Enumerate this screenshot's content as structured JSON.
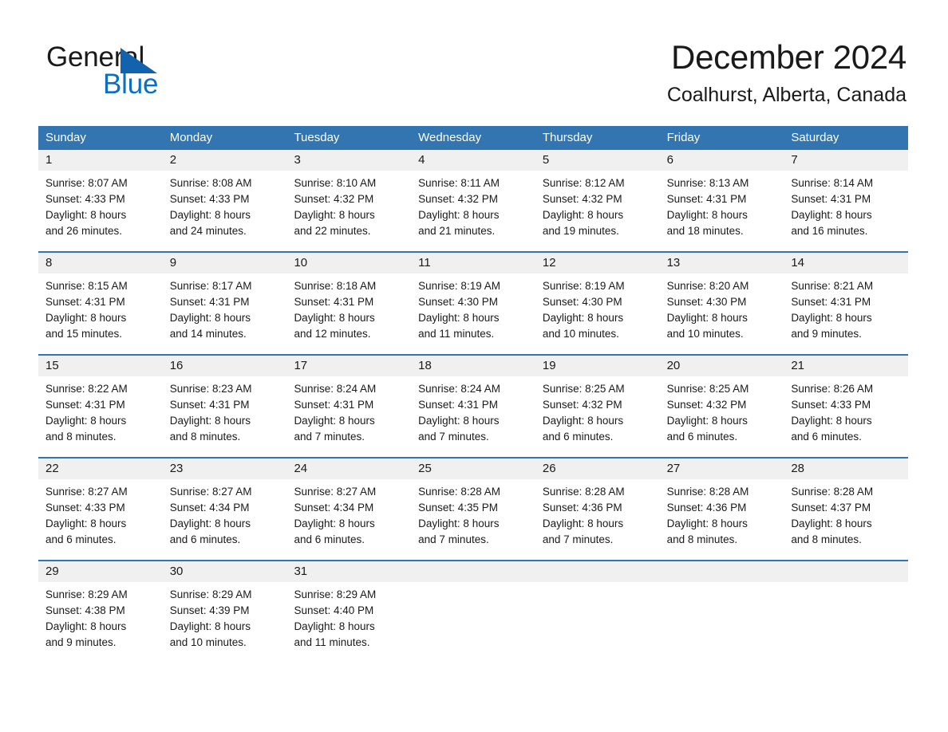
{
  "brand": {
    "name_top": "General",
    "name_bottom": "Blue",
    "triangle_color": "#1263ae",
    "blue_text_color": "#0b6fc4"
  },
  "header": {
    "month_title": "December 2024",
    "location": "Coalhurst, Alberta, Canada"
  },
  "theme": {
    "header_blue": "#3275b1",
    "row_divider_blue": "#3275b1",
    "date_band_gray": "#f0f0f0"
  },
  "weekdays": [
    "Sunday",
    "Monday",
    "Tuesday",
    "Wednesday",
    "Thursday",
    "Friday",
    "Saturday"
  ],
  "weeks": [
    {
      "days": [
        {
          "date": "1",
          "sunrise": "Sunrise: 8:07 AM",
          "sunset": "Sunset: 4:33 PM",
          "daylight_1": "Daylight: 8 hours",
          "daylight_2": "and 26 minutes."
        },
        {
          "date": "2",
          "sunrise": "Sunrise: 8:08 AM",
          "sunset": "Sunset: 4:33 PM",
          "daylight_1": "Daylight: 8 hours",
          "daylight_2": "and 24 minutes."
        },
        {
          "date": "3",
          "sunrise": "Sunrise: 8:10 AM",
          "sunset": "Sunset: 4:32 PM",
          "daylight_1": "Daylight: 8 hours",
          "daylight_2": "and 22 minutes."
        },
        {
          "date": "4",
          "sunrise": "Sunrise: 8:11 AM",
          "sunset": "Sunset: 4:32 PM",
          "daylight_1": "Daylight: 8 hours",
          "daylight_2": "and 21 minutes."
        },
        {
          "date": "5",
          "sunrise": "Sunrise: 8:12 AM",
          "sunset": "Sunset: 4:32 PM",
          "daylight_1": "Daylight: 8 hours",
          "daylight_2": "and 19 minutes."
        },
        {
          "date": "6",
          "sunrise": "Sunrise: 8:13 AM",
          "sunset": "Sunset: 4:31 PM",
          "daylight_1": "Daylight: 8 hours",
          "daylight_2": "and 18 minutes."
        },
        {
          "date": "7",
          "sunrise": "Sunrise: 8:14 AM",
          "sunset": "Sunset: 4:31 PM",
          "daylight_1": "Daylight: 8 hours",
          "daylight_2": "and 16 minutes."
        }
      ]
    },
    {
      "days": [
        {
          "date": "8",
          "sunrise": "Sunrise: 8:15 AM",
          "sunset": "Sunset: 4:31 PM",
          "daylight_1": "Daylight: 8 hours",
          "daylight_2": "and 15 minutes."
        },
        {
          "date": "9",
          "sunrise": "Sunrise: 8:17 AM",
          "sunset": "Sunset: 4:31 PM",
          "daylight_1": "Daylight: 8 hours",
          "daylight_2": "and 14 minutes."
        },
        {
          "date": "10",
          "sunrise": "Sunrise: 8:18 AM",
          "sunset": "Sunset: 4:31 PM",
          "daylight_1": "Daylight: 8 hours",
          "daylight_2": "and 12 minutes."
        },
        {
          "date": "11",
          "sunrise": "Sunrise: 8:19 AM",
          "sunset": "Sunset: 4:30 PM",
          "daylight_1": "Daylight: 8 hours",
          "daylight_2": "and 11 minutes."
        },
        {
          "date": "12",
          "sunrise": "Sunrise: 8:19 AM",
          "sunset": "Sunset: 4:30 PM",
          "daylight_1": "Daylight: 8 hours",
          "daylight_2": "and 10 minutes."
        },
        {
          "date": "13",
          "sunrise": "Sunrise: 8:20 AM",
          "sunset": "Sunset: 4:30 PM",
          "daylight_1": "Daylight: 8 hours",
          "daylight_2": "and 10 minutes."
        },
        {
          "date": "14",
          "sunrise": "Sunrise: 8:21 AM",
          "sunset": "Sunset: 4:31 PM",
          "daylight_1": "Daylight: 8 hours",
          "daylight_2": "and 9 minutes."
        }
      ]
    },
    {
      "days": [
        {
          "date": "15",
          "sunrise": "Sunrise: 8:22 AM",
          "sunset": "Sunset: 4:31 PM",
          "daylight_1": "Daylight: 8 hours",
          "daylight_2": "and 8 minutes."
        },
        {
          "date": "16",
          "sunrise": "Sunrise: 8:23 AM",
          "sunset": "Sunset: 4:31 PM",
          "daylight_1": "Daylight: 8 hours",
          "daylight_2": "and 8 minutes."
        },
        {
          "date": "17",
          "sunrise": "Sunrise: 8:24 AM",
          "sunset": "Sunset: 4:31 PM",
          "daylight_1": "Daylight: 8 hours",
          "daylight_2": "and 7 minutes."
        },
        {
          "date": "18",
          "sunrise": "Sunrise: 8:24 AM",
          "sunset": "Sunset: 4:31 PM",
          "daylight_1": "Daylight: 8 hours",
          "daylight_2": "and 7 minutes."
        },
        {
          "date": "19",
          "sunrise": "Sunrise: 8:25 AM",
          "sunset": "Sunset: 4:32 PM",
          "daylight_1": "Daylight: 8 hours",
          "daylight_2": "and 6 minutes."
        },
        {
          "date": "20",
          "sunrise": "Sunrise: 8:25 AM",
          "sunset": "Sunset: 4:32 PM",
          "daylight_1": "Daylight: 8 hours",
          "daylight_2": "and 6 minutes."
        },
        {
          "date": "21",
          "sunrise": "Sunrise: 8:26 AM",
          "sunset": "Sunset: 4:33 PM",
          "daylight_1": "Daylight: 8 hours",
          "daylight_2": "and 6 minutes."
        }
      ]
    },
    {
      "days": [
        {
          "date": "22",
          "sunrise": "Sunrise: 8:27 AM",
          "sunset": "Sunset: 4:33 PM",
          "daylight_1": "Daylight: 8 hours",
          "daylight_2": "and 6 minutes."
        },
        {
          "date": "23",
          "sunrise": "Sunrise: 8:27 AM",
          "sunset": "Sunset: 4:34 PM",
          "daylight_1": "Daylight: 8 hours",
          "daylight_2": "and 6 minutes."
        },
        {
          "date": "24",
          "sunrise": "Sunrise: 8:27 AM",
          "sunset": "Sunset: 4:34 PM",
          "daylight_1": "Daylight: 8 hours",
          "daylight_2": "and 6 minutes."
        },
        {
          "date": "25",
          "sunrise": "Sunrise: 8:28 AM",
          "sunset": "Sunset: 4:35 PM",
          "daylight_1": "Daylight: 8 hours",
          "daylight_2": "and 7 minutes."
        },
        {
          "date": "26",
          "sunrise": "Sunrise: 8:28 AM",
          "sunset": "Sunset: 4:36 PM",
          "daylight_1": "Daylight: 8 hours",
          "daylight_2": "and 7 minutes."
        },
        {
          "date": "27",
          "sunrise": "Sunrise: 8:28 AM",
          "sunset": "Sunset: 4:36 PM",
          "daylight_1": "Daylight: 8 hours",
          "daylight_2": "and 8 minutes."
        },
        {
          "date": "28",
          "sunrise": "Sunrise: 8:28 AM",
          "sunset": "Sunset: 4:37 PM",
          "daylight_1": "Daylight: 8 hours",
          "daylight_2": "and 8 minutes."
        }
      ]
    },
    {
      "days": [
        {
          "date": "29",
          "sunrise": "Sunrise: 8:29 AM",
          "sunset": "Sunset: 4:38 PM",
          "daylight_1": "Daylight: 8 hours",
          "daylight_2": "and 9 minutes."
        },
        {
          "date": "30",
          "sunrise": "Sunrise: 8:29 AM",
          "sunset": "Sunset: 4:39 PM",
          "daylight_1": "Daylight: 8 hours",
          "daylight_2": "and 10 minutes."
        },
        {
          "date": "31",
          "sunrise": "Sunrise: 8:29 AM",
          "sunset": "Sunset: 4:40 PM",
          "daylight_1": "Daylight: 8 hours",
          "daylight_2": "and 11 minutes."
        },
        {
          "date": "",
          "sunrise": "",
          "sunset": "",
          "daylight_1": "",
          "daylight_2": ""
        },
        {
          "date": "",
          "sunrise": "",
          "sunset": "",
          "daylight_1": "",
          "daylight_2": ""
        },
        {
          "date": "",
          "sunrise": "",
          "sunset": "",
          "daylight_1": "",
          "daylight_2": ""
        },
        {
          "date": "",
          "sunrise": "",
          "sunset": "",
          "daylight_1": "",
          "daylight_2": ""
        }
      ]
    }
  ]
}
